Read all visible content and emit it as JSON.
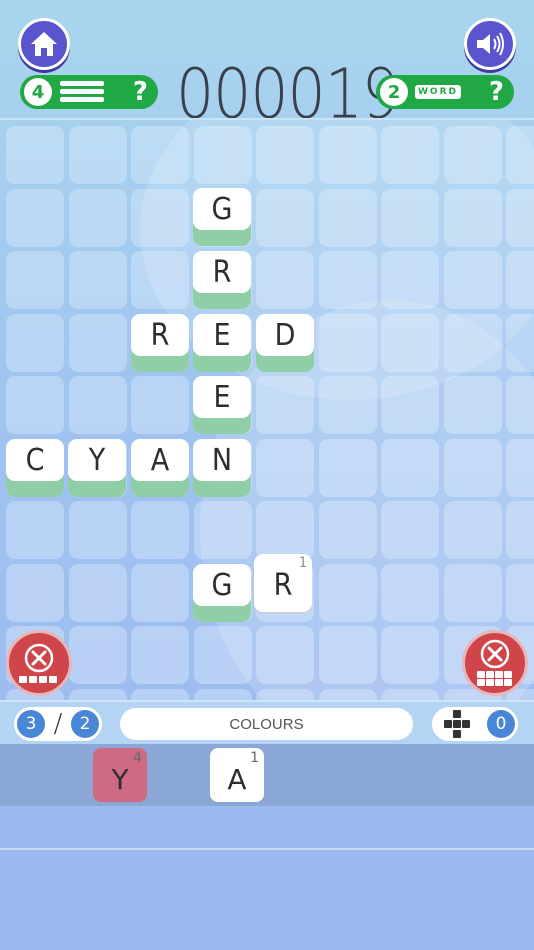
{
  "header": {
    "score": "000019",
    "left_pill": {
      "count": "4",
      "help": "?"
    },
    "right_pill": {
      "count": "2",
      "word_label": "WORD",
      "help": "?"
    }
  },
  "board": {
    "placed_tiles": [
      {
        "letter": "G",
        "number": ""
      },
      {
        "letter": "R",
        "number": ""
      },
      {
        "letter": "R",
        "number": ""
      },
      {
        "letter": "E",
        "number": ""
      },
      {
        "letter": "D",
        "number": ""
      },
      {
        "letter": "E",
        "number": ""
      },
      {
        "letter": "C",
        "number": ""
      },
      {
        "letter": "Y",
        "number": ""
      },
      {
        "letter": "A",
        "number": ""
      },
      {
        "letter": "N",
        "number": ""
      },
      {
        "letter": "G",
        "number": ""
      },
      {
        "letter": "R",
        "number": "1"
      }
    ]
  },
  "info": {
    "words_found": "3",
    "slash": "/",
    "words_total": "2",
    "category": "COLOURS",
    "cross_count": "0"
  },
  "rack": {
    "tiles": [
      {
        "letter": "Y",
        "number": "4",
        "color": "#cf6a84"
      },
      {
        "letter": "A",
        "number": "1",
        "color": "#ffffff"
      }
    ]
  },
  "colors": {
    "accent_purple": "#5a55cf",
    "green": "#1fa843",
    "tile_base": "#8fcea6",
    "delete_red": "#cf4549",
    "count_blue": "#4a86d6"
  }
}
